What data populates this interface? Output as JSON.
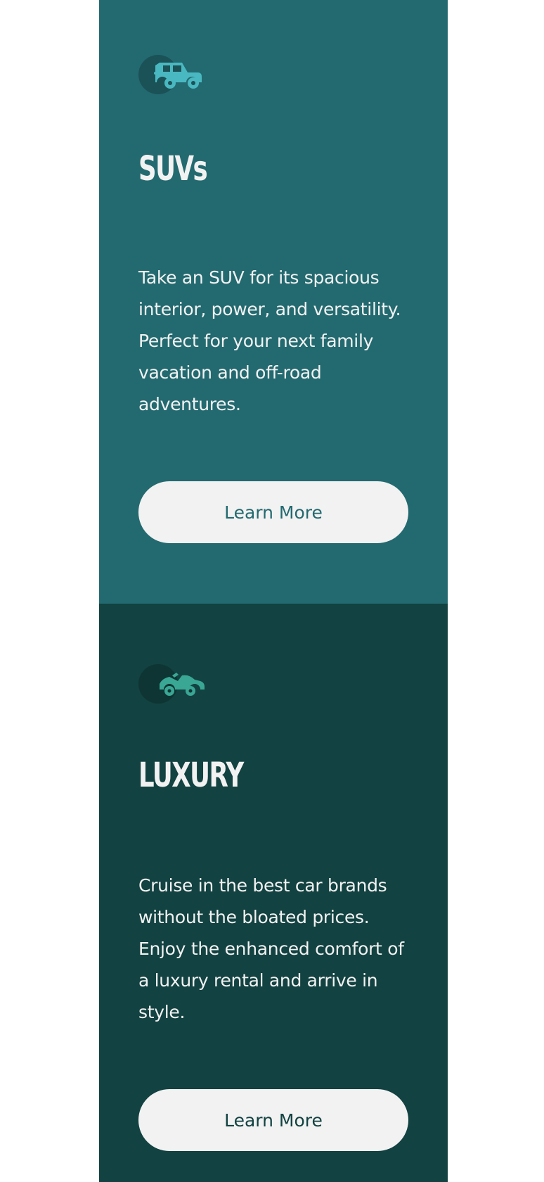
{
  "colors": {
    "suvs_bg": "#236a70",
    "luxury_bg": "#124241",
    "suvs_icon": "#4ab8c1",
    "luxury_icon": "#3aa795",
    "button_bg": "#f2f2f2",
    "text": "#f2f2f2"
  },
  "cards": [
    {
      "icon": "suv-icon",
      "title": "SUVs",
      "text": "Take an SUV for its spacious interior, power, and versatility. Perfect for your next family vacation and off-road adventures.",
      "button_label": "Learn More"
    },
    {
      "icon": "luxury-car-icon",
      "title": "LUXURY",
      "text": "Cruise in the best car brands without the bloated prices. Enjoy the enhanced comfort of a luxury rental and arrive in style.",
      "button_label": "Learn More"
    }
  ]
}
